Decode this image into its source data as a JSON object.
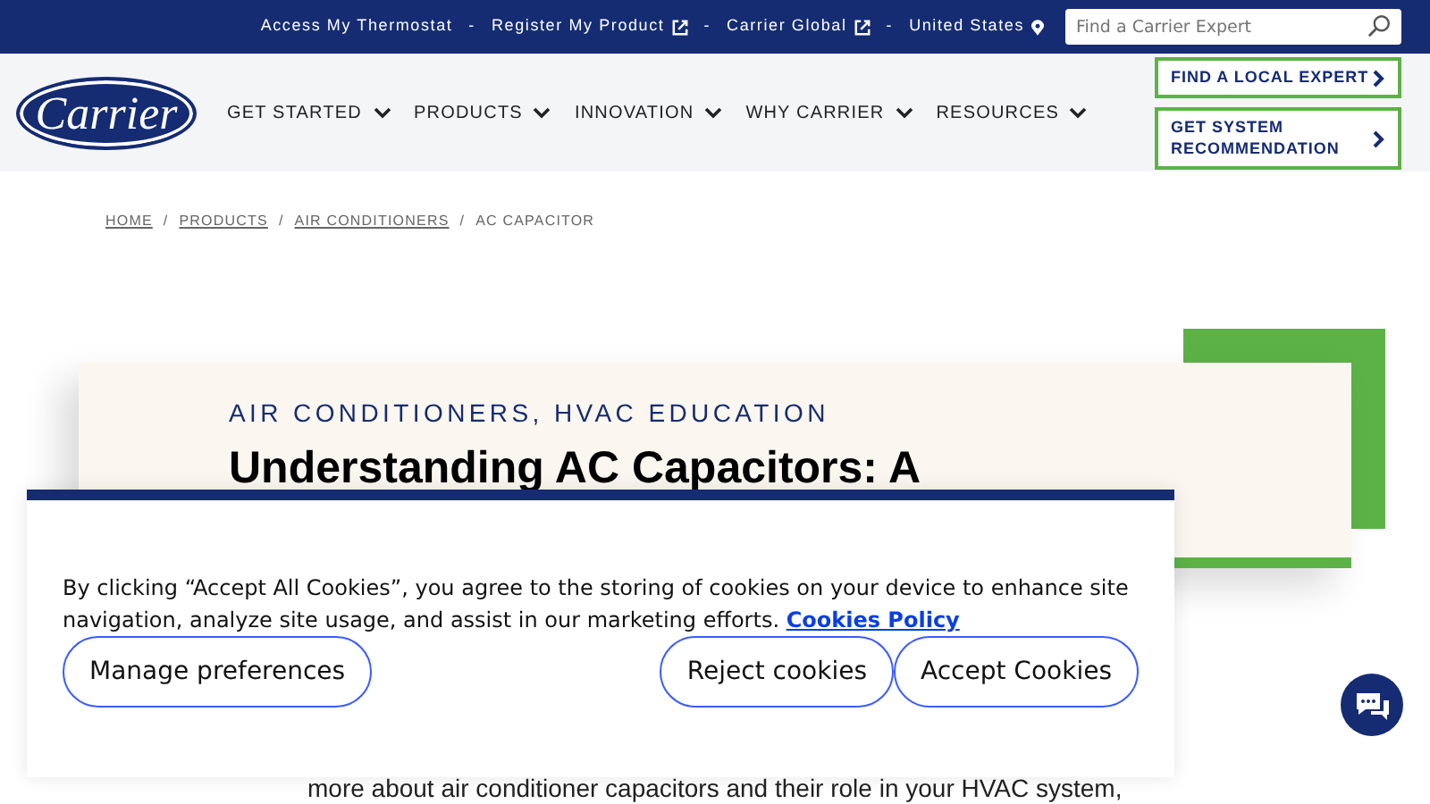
{
  "utility_nav": {
    "links": [
      {
        "label": "Access My Thermostat",
        "external": false,
        "location": false
      },
      {
        "label": "Register My Product",
        "external": true,
        "location": false
      },
      {
        "label": "Carrier Global",
        "external": true,
        "location": false
      },
      {
        "label": "United States",
        "external": false,
        "location": true
      }
    ],
    "separator": "-",
    "search": {
      "placeholder": "Find a Carrier Expert"
    }
  },
  "logo": {
    "text": "Carrier"
  },
  "main_nav": [
    {
      "label": "GET STARTED"
    },
    {
      "label": "PRODUCTS"
    },
    {
      "label": "INNOVATION"
    },
    {
      "label": "WHY CARRIER"
    },
    {
      "label": "RESOURCES"
    }
  ],
  "cta_buttons": [
    {
      "label": "FIND A LOCAL EXPERT"
    },
    {
      "label": "GET SYSTEM RECOMMENDATION"
    }
  ],
  "breadcrumb": [
    {
      "label": "HOME",
      "link": true
    },
    {
      "label": "PRODUCTS",
      "link": true
    },
    {
      "label": "AIR CONDITIONERS",
      "link": true
    },
    {
      "label": "AC CAPACITOR",
      "link": false
    }
  ],
  "breadcrumb_separator": "/",
  "article": {
    "category": "AIR CONDITIONERS, HVAC EDUCATION",
    "title": "Understanding AC Capacitors: A",
    "body_visible": "more about air conditioner capacitors and their role in your HVAC system,"
  },
  "cookie_banner": {
    "text": "By clicking “Accept All Cookies”, you agree to the storing of cookies on your device to enhance site navigation, analyze site usage, and assist in our marketing efforts.",
    "policy_link": "Cookies Policy",
    "buttons": [
      {
        "label": "Manage preferences"
      },
      {
        "label": "Reject cookies"
      },
      {
        "label": "Accept Cookies"
      }
    ]
  }
}
